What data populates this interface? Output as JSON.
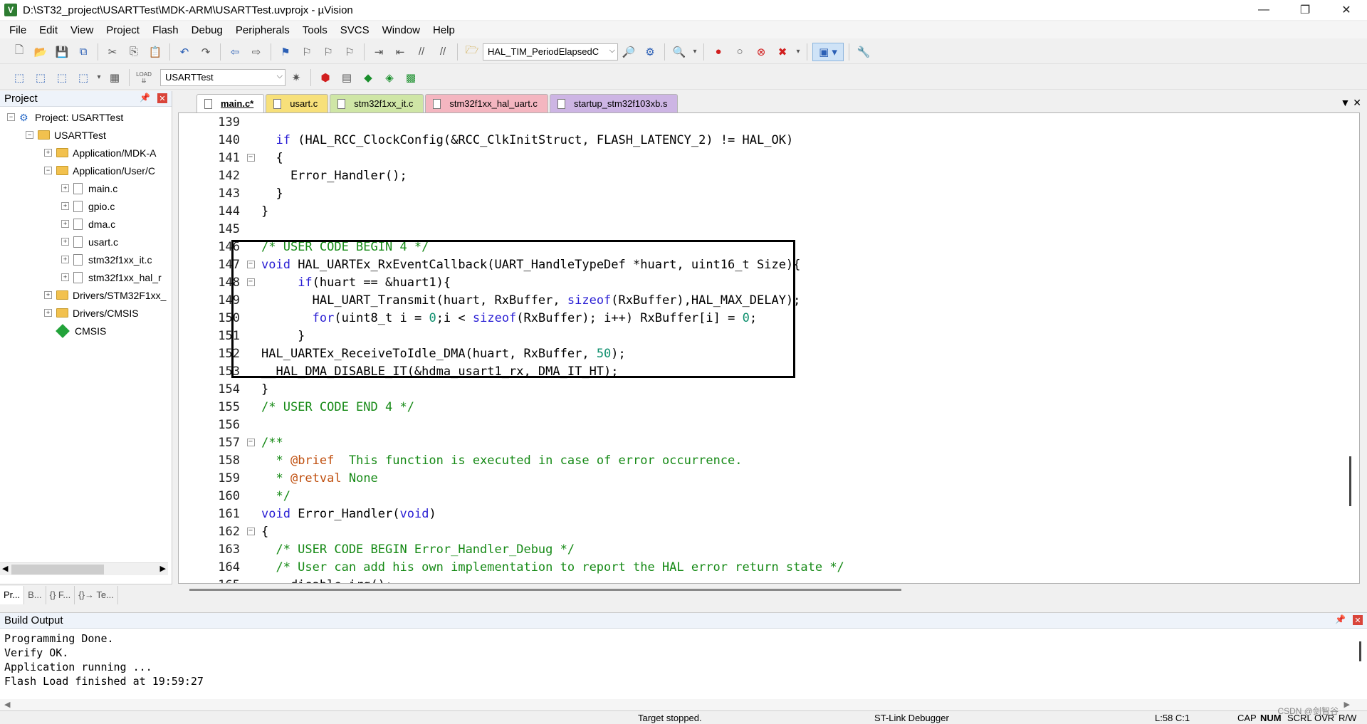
{
  "window": {
    "title": "D:\\ST32_project\\USARTTest\\MDK-ARM\\USARTTest.uvprojx - µVision",
    "minimize": "—",
    "maximize": "❐",
    "close": "✕"
  },
  "menu": [
    "File",
    "Edit",
    "View",
    "Project",
    "Flash",
    "Debug",
    "Peripherals",
    "Tools",
    "SVCS",
    "Window",
    "Help"
  ],
  "toolbar1": {
    "function_combo": "HAL_TIM_PeriodElapsedC"
  },
  "toolbar2": {
    "target_combo": "USARTTest",
    "load_label": "LOAD"
  },
  "project_panel": {
    "title": "Project",
    "tree": {
      "root": "Project: USARTTest",
      "target": "USARTTest",
      "group1": "Application/MDK-A",
      "group2": "Application/User/C",
      "file1": "main.c",
      "file2": "gpio.c",
      "file3": "dma.c",
      "file4": "usart.c",
      "file5": "stm32f1xx_it.c",
      "file6": "stm32f1xx_hal_r",
      "group3": "Drivers/STM32F1xx_",
      "group4": "Drivers/CMSIS",
      "cmsis": "CMSIS"
    },
    "tabs": [
      "Pr...",
      "B...",
      "{} F...",
      "{}→ Te..."
    ]
  },
  "editor": {
    "tabs": [
      "main.c*",
      "usart.c",
      "stm32f1xx_it.c",
      "stm32f1xx_hal_uart.c",
      "startup_stm32f103xb.s"
    ],
    "lines": [
      {
        "n": "139",
        "c": ""
      },
      {
        "n": "140",
        "c": "  if (HAL_RCC_ClockConfig(&RCC_ClkInitStruct, FLASH_LATENCY_2) != HAL_OK)"
      },
      {
        "n": "141",
        "c": "  {"
      },
      {
        "n": "142",
        "c": "    Error_Handler();"
      },
      {
        "n": "143",
        "c": "  }"
      },
      {
        "n": "144",
        "c": "}"
      },
      {
        "n": "145",
        "c": ""
      },
      {
        "n": "146",
        "c": "/* USER CODE BEGIN 4 */"
      },
      {
        "n": "147",
        "c": "void HAL_UARTEx_RxEventCallback(UART_HandleTypeDef *huart, uint16_t Size){"
      },
      {
        "n": "148",
        "c": "     if(huart == &huart1){"
      },
      {
        "n": "149",
        "c": "       HAL_UART_Transmit(huart, RxBuffer, sizeof(RxBuffer),HAL_MAX_DELAY);"
      },
      {
        "n": "150",
        "c": "       for(uint8_t i = 0;i < sizeof(RxBuffer); i++) RxBuffer[i] = 0;"
      },
      {
        "n": "151",
        "c": "     }"
      },
      {
        "n": "152",
        "c": "HAL_UARTEx_ReceiveToIdle_DMA(huart, RxBuffer, 50);"
      },
      {
        "n": "153",
        "c": "__HAL_DMA_DISABLE_IT(&hdma_usart1_rx, DMA_IT_HT);"
      },
      {
        "n": "154",
        "c": "}"
      },
      {
        "n": "155",
        "c": "/* USER CODE END 4 */"
      },
      {
        "n": "156",
        "c": ""
      },
      {
        "n": "157",
        "c": "/**"
      },
      {
        "n": "158",
        "c": "  * @brief  This function is executed in case of error occurrence."
      },
      {
        "n": "159",
        "c": "  * @retval None"
      },
      {
        "n": "160",
        "c": "  */"
      },
      {
        "n": "161",
        "c": "void Error_Handler(void)"
      },
      {
        "n": "162",
        "c": "{"
      },
      {
        "n": "163",
        "c": "  /* USER CODE BEGIN Error_Handler_Debug */"
      },
      {
        "n": "164",
        "c": "  /* User can add his own implementation to report the HAL error return state */"
      },
      {
        "n": "165",
        "c": "  __disable_irq();"
      }
    ]
  },
  "build_output": {
    "title": "Build Output",
    "lines": [
      "Programming Done.",
      "Verify OK.",
      "Application running ...",
      "Flash Load finished at 19:59:27"
    ]
  },
  "status": {
    "target_state": "Target stopped.",
    "debugger": "ST-Link Debugger",
    "position": "L:58 C:1",
    "cap": "CAP",
    "num": "NUM",
    "scrl": "SCRL",
    "ovr": "OVR",
    "rw": "R/W"
  },
  "watermark": "CSDN @剑智谷"
}
